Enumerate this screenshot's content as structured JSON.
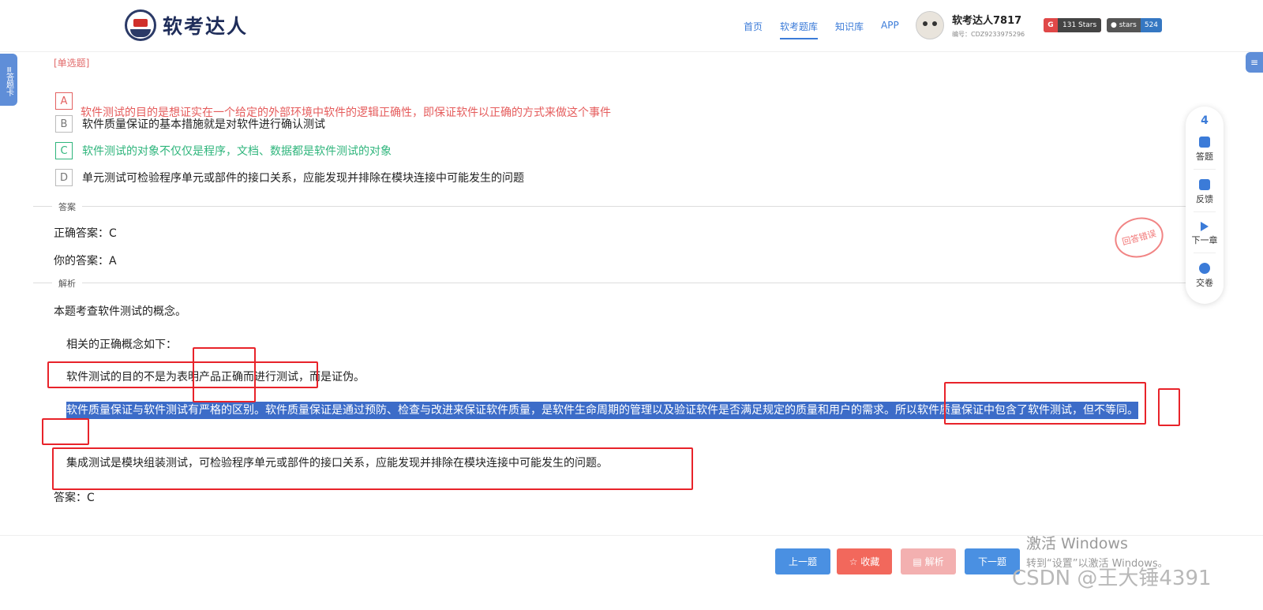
{
  "header": {
    "logo_text": "软考达人",
    "nav": [
      {
        "label": "首页",
        "active": false
      },
      {
        "label": "软考题库",
        "active": true
      },
      {
        "label": "知识库",
        "active": false
      },
      {
        "label": "APP",
        "active": false
      }
    ],
    "user_name": "软考达人7817",
    "user_id": "编号：CDZ9233975296",
    "badge_g_icon": "G",
    "badge_g_label": "131 Stars",
    "badge_s_label": "stars",
    "badge_s_count": "524"
  },
  "side": {
    "answer_card_label": "答题卡",
    "right_tab_icon": "≡"
  },
  "question": {
    "type_label": "[单选题]",
    "options": [
      {
        "key": "A",
        "text": "软件测试的目的是想证实在一个给定的外部环境中软件的逻辑正确性，即保证软件以正确的方式来做这个事件"
      },
      {
        "key": "B",
        "text": "软件质量保证的基本措施就是对软件进行确认测试"
      },
      {
        "key": "C",
        "text": "软件测试的对象不仅仅是程序，文档、数据都是软件测试的对象"
      },
      {
        "key": "D",
        "text": "单元测试可检验程序单元或部件的接口关系，应能发现并排除在模块连接中可能发生的问题"
      }
    ]
  },
  "answer": {
    "section_label": "答案",
    "correct": "正确答案：C",
    "yours": "你的答案：A",
    "stamp": "回答错误"
  },
  "analysis": {
    "section_label": "解析",
    "p1": "本题考查软件测试的概念。",
    "p2": "相关的正确概念如下：",
    "p3": "软件测试的目的不是为表明产品正确而进行测试，而是证伪。",
    "p4": "软件质量保证与软件测试有严格的区别。软件质量保证是通过预防、检查与改进来保证软件质量，是软件生命周期的管理以及验证软件是否满足规定的质量和用户的需求。所以软件质量保证中包含了软件测试，但不等同。",
    "p5": "集成测试是模块组装测试，可检验程序单元或部件的接口关系，应能发现并排除在模块连接中可能发生的问题。",
    "p6": "答案：C"
  },
  "float_panel": {
    "count": "4",
    "items": [
      "答题",
      "反馈",
      "下一章",
      "交卷"
    ]
  },
  "buttons": {
    "prev": "上一题",
    "fav": "☆ 收藏",
    "analysis": "▤ 解析",
    "next": "下一题"
  },
  "watermark": {
    "line1": "激活 Windows",
    "line2": "转到“设置”以激活 Windows。",
    "csdn": "CSDN @王大锤4391"
  }
}
